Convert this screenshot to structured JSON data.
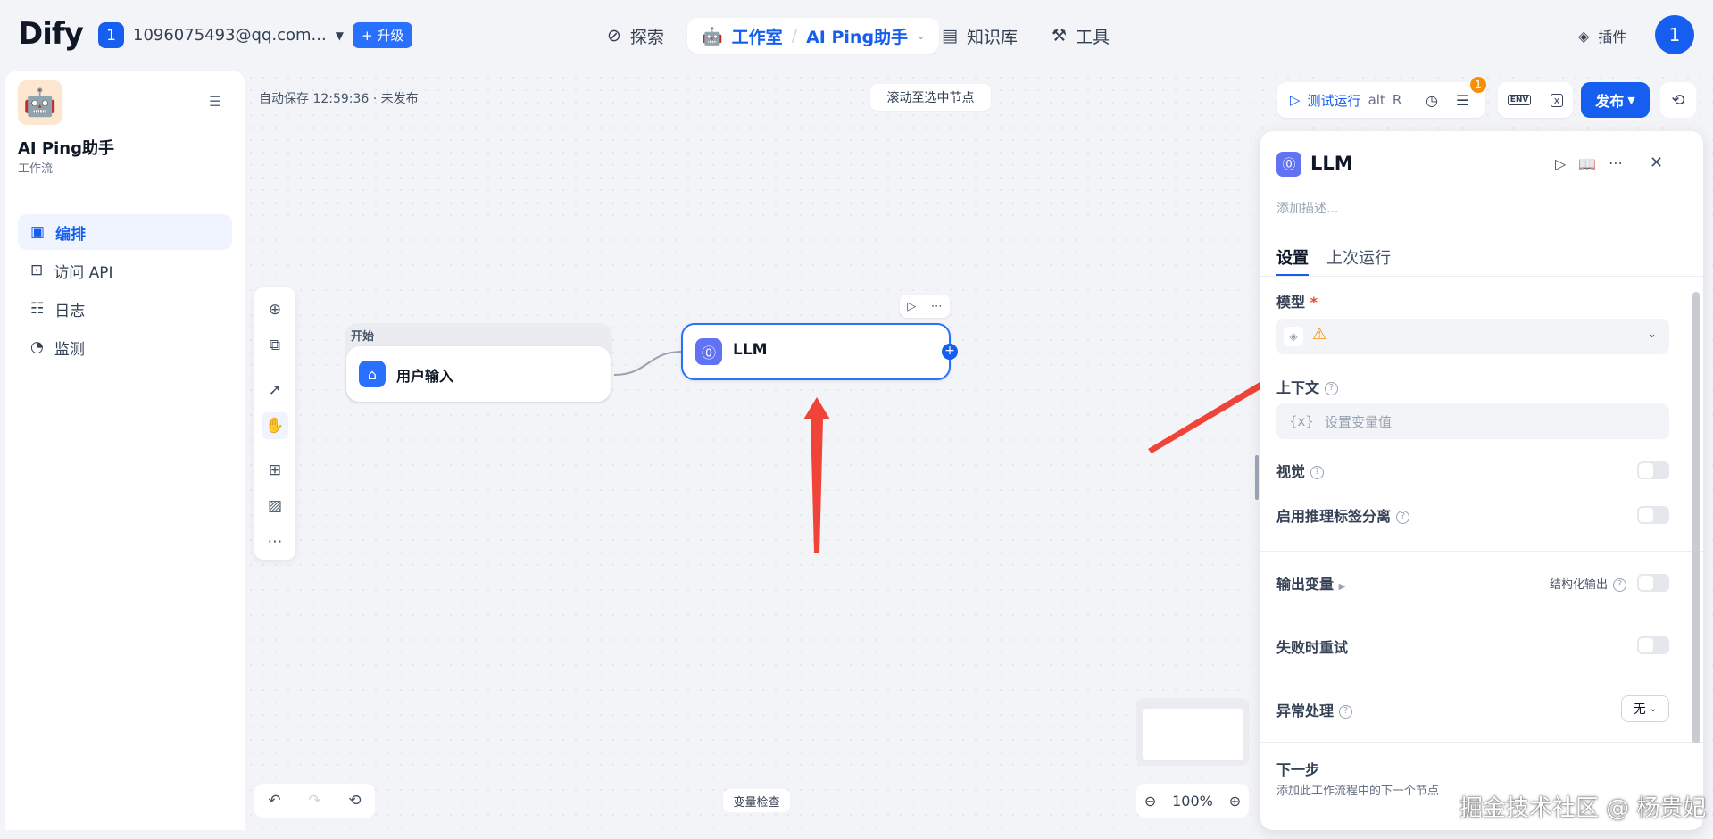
{
  "header": {
    "logo": "Dify",
    "account_badge": "1",
    "account_email": "1096075493@qq.com...",
    "upgrade_label": "升级",
    "explore": "探索",
    "studio": "工作室",
    "app_switch": "AI Ping助手",
    "knowledge": "知识库",
    "tools": "工具",
    "plugins": "插件",
    "avatar": "1"
  },
  "sidebar": {
    "app_name": "AI Ping助手",
    "app_type": "工作流",
    "items": [
      {
        "label": "编排"
      },
      {
        "label": "访问 API"
      },
      {
        "label": "日志"
      },
      {
        "label": "监测"
      }
    ]
  },
  "canvas": {
    "autosave": "自动保存 12:59:36 · 未发布",
    "scroll_to_node": "滚动至选中节点",
    "start_group": "开始",
    "start_node": "用户输入",
    "llm_node": "LLM",
    "var_inspect": "变量检查",
    "zoom": "100%"
  },
  "run_toolbar": {
    "test_run": "测试运行",
    "shortcut_alt": "alt",
    "shortcut_r": "R",
    "checklist_count": "1",
    "env": "ENV",
    "publish": "发布"
  },
  "panel": {
    "title": "LLM",
    "desc_placeholder": "添加描述...",
    "tab_settings": "设置",
    "tab_last_run": "上次运行",
    "model_label": "模型",
    "required_mark": "*",
    "context_label": "上下文",
    "context_prefix": "{x}",
    "context_placeholder": "设置变量值",
    "vision_label": "视觉",
    "reasoning_label": "启用推理标签分离",
    "output_vars_label": "输出变量",
    "structured_output_label": "结构化输出",
    "retry_label": "失败时重试",
    "error_handling_label": "异常处理",
    "error_handling_value": "无",
    "next_step_label": "下一步",
    "next_step_desc": "添加此工作流程中的下一个节点"
  },
  "watermark": "掘金技术社区 @ 杨贵妃",
  "colors": {
    "accent": "#155eef",
    "arrow": "#f04438",
    "badge": "#f79009"
  }
}
